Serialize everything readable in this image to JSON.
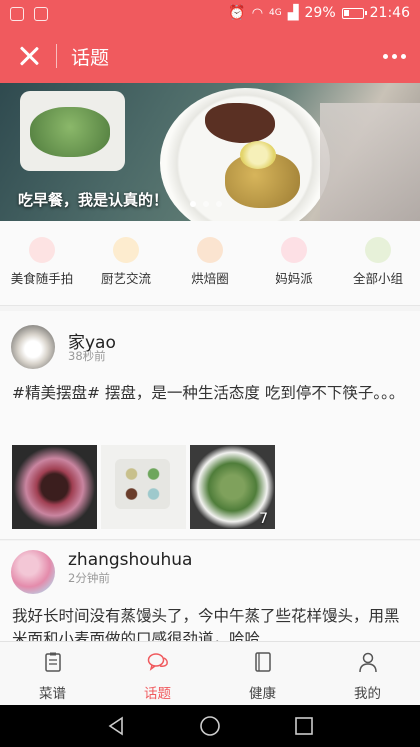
{
  "status_bar": {
    "network": "4G",
    "battery": "29%",
    "time": "21:46"
  },
  "header": {
    "title": "话题"
  },
  "banner": {
    "caption": "吃早餐，我是认真的！"
  },
  "categories": [
    {
      "label": "美食随手拍",
      "color": "#f27d7d"
    },
    {
      "label": "厨艺交流",
      "color": "#f0b15c"
    },
    {
      "label": "烘焙圈",
      "color": "#e89b5c"
    },
    {
      "label": "妈妈派",
      "color": "#f08c9c"
    },
    {
      "label": "全部小组",
      "color": "#9cc46a"
    }
  ],
  "posts": [
    {
      "username": "家yao",
      "time": "38秒前",
      "text": "#精美摆盘# 摆盘，是一种生活态度 吃到停不下筷子。。。",
      "photo_count": "7"
    },
    {
      "username": "zhangshouhua",
      "time": "2分钟前",
      "text": "我好长时间没有蒸馒头了，今中午蒸了些花样馒头，用黑米面和小麦面做的口感很劲道，哈哈"
    }
  ],
  "bottom_nav": [
    {
      "label": "菜谱",
      "icon": "clipboard-icon"
    },
    {
      "label": "话题",
      "icon": "chat-bubble-icon",
      "active": true
    },
    {
      "label": "健康",
      "icon": "book-icon"
    },
    {
      "label": "我的",
      "icon": "person-icon"
    }
  ],
  "colors": {
    "accent": "#f05a5e"
  }
}
